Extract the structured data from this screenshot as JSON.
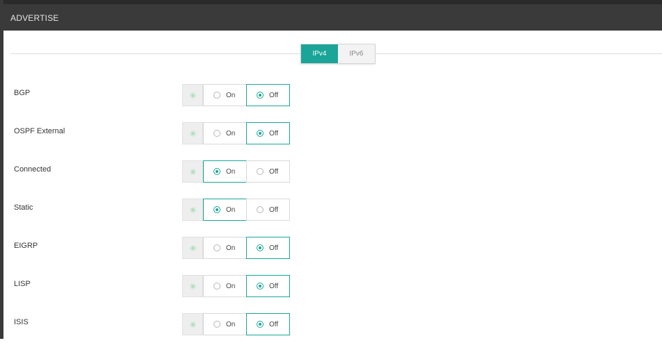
{
  "header": {
    "title": "ADVERTISE"
  },
  "tabs": [
    {
      "label": "IPv4",
      "active": true
    },
    {
      "label": "IPv6",
      "active": false
    }
  ],
  "colors": {
    "accent": "#1aa598",
    "header_bg": "#3a3a3a",
    "status_dot": "#b9dcc0"
  },
  "rows": [
    {
      "label": "BGP",
      "on_label": "On",
      "off_label": "Off",
      "selected": "off"
    },
    {
      "label": "OSPF External",
      "on_label": "On",
      "off_label": "Off",
      "selected": "off"
    },
    {
      "label": "Connected",
      "on_label": "On",
      "off_label": "Off",
      "selected": "on"
    },
    {
      "label": "Static",
      "on_label": "On",
      "off_label": "Off",
      "selected": "on"
    },
    {
      "label": "EIGRP",
      "on_label": "On",
      "off_label": "Off",
      "selected": "off"
    },
    {
      "label": "LISP",
      "on_label": "On",
      "off_label": "Off",
      "selected": "off"
    },
    {
      "label": "ISIS",
      "on_label": "On",
      "off_label": "Off",
      "selected": "off"
    }
  ]
}
